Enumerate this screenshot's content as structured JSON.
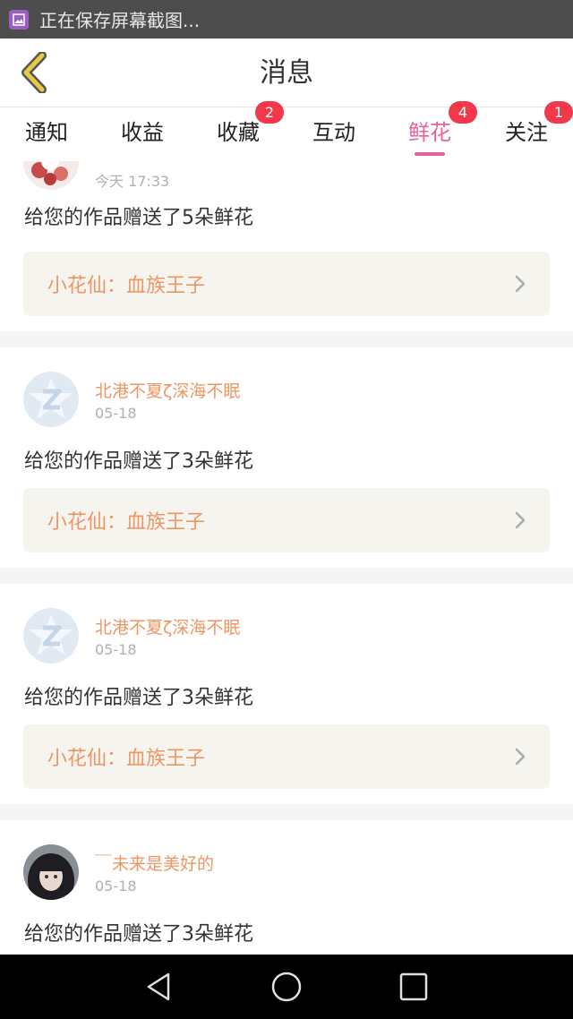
{
  "statusbar": {
    "text": "正在保存屏幕截图..."
  },
  "header": {
    "title": "消息"
  },
  "tabs": [
    {
      "label": "通知",
      "badge": ""
    },
    {
      "label": "收益",
      "badge": ""
    },
    {
      "label": "收藏",
      "badge": "2"
    },
    {
      "label": "互动",
      "badge": ""
    },
    {
      "label": "鲜花",
      "badge": "4",
      "active": true
    },
    {
      "label": "关注",
      "badge": "1"
    }
  ],
  "feed": {
    "items": [
      {
        "username": "",
        "time": "今天 17:33",
        "message": "给您的作品赠送了5朵鲜花",
        "work": "小花仙：血族王子",
        "avatar": "floral-avatar"
      },
      {
        "username": "北港不夏ζ深海不眠",
        "time": "05-18",
        "message": "给您的作品赠送了3朵鲜花",
        "work": "小花仙：血族王子",
        "avatar": "default-z-avatar"
      },
      {
        "username": "北港不夏ζ深海不眠",
        "time": "05-18",
        "message": "给您的作品赠送了3朵鲜花",
        "work": "小花仙：血族王子",
        "avatar": "default-z-avatar"
      },
      {
        "username": "￣未来是美好的",
        "time": "05-18",
        "message": "给您的作品赠送了3朵鲜花",
        "work": "",
        "avatar": "girl-photo-avatar"
      }
    ]
  },
  "colors": {
    "accent": "#e7619a",
    "badge": "#f2384a",
    "username": "#ee9663",
    "back_icon": "#e8c94a"
  }
}
